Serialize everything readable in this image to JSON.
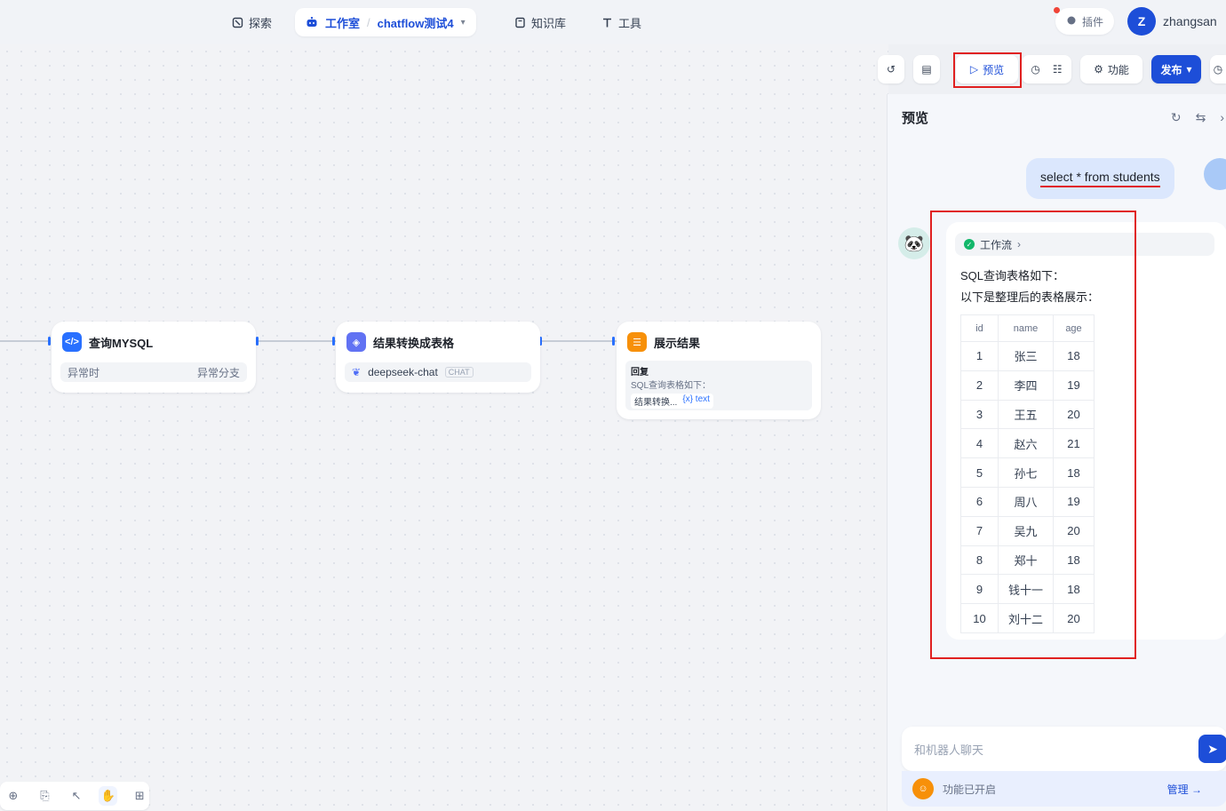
{
  "nav": {
    "explore": "探索",
    "studio": "工作室",
    "app_name": "chatflow测试4",
    "knowledge": "知识库",
    "tools": "工具",
    "plugins": "插件",
    "avatar_initial": "Z",
    "username": "zhangsan"
  },
  "toolbar": {
    "preview": "预览",
    "features": "功能",
    "publish": "发布"
  },
  "nodes": [
    {
      "title": "查询MYSQL",
      "left_label": "异常时",
      "right_label": "异常分支",
      "icon_color": "#2970ff"
    },
    {
      "title": "结果转换成表格",
      "model": "deepseek-chat",
      "badge": "CHAT",
      "icon_color": "#6172f3"
    },
    {
      "title": "展示结果",
      "answer_label": "回复",
      "answer_text": "SQL查询表格如下：",
      "var_node": "结果转换...",
      "var_name": "{x} text",
      "icon_color": "#f79009"
    }
  ],
  "preview": {
    "title": "预览",
    "user_message": "select * from students",
    "workflow_label": "工作流",
    "line1": "SQL查询表格如下：",
    "line2": "以下是整理后的表格展示：",
    "table": {
      "headers": [
        "id",
        "name",
        "age"
      ],
      "rows": [
        [
          "1",
          "张三",
          "18"
        ],
        [
          "2",
          "李四",
          "19"
        ],
        [
          "3",
          "王五",
          "20"
        ],
        [
          "4",
          "赵六",
          "21"
        ],
        [
          "5",
          "孙七",
          "18"
        ],
        [
          "6",
          "周八",
          "19"
        ],
        [
          "7",
          "吴九",
          "20"
        ],
        [
          "8",
          "郑十",
          "18"
        ],
        [
          "9",
          "钱十一",
          "18"
        ],
        [
          "10",
          "刘十二",
          "20"
        ]
      ]
    },
    "input_placeholder": "和机器人聊天",
    "features_enabled": "功能已开启",
    "manage": "管理 →"
  }
}
